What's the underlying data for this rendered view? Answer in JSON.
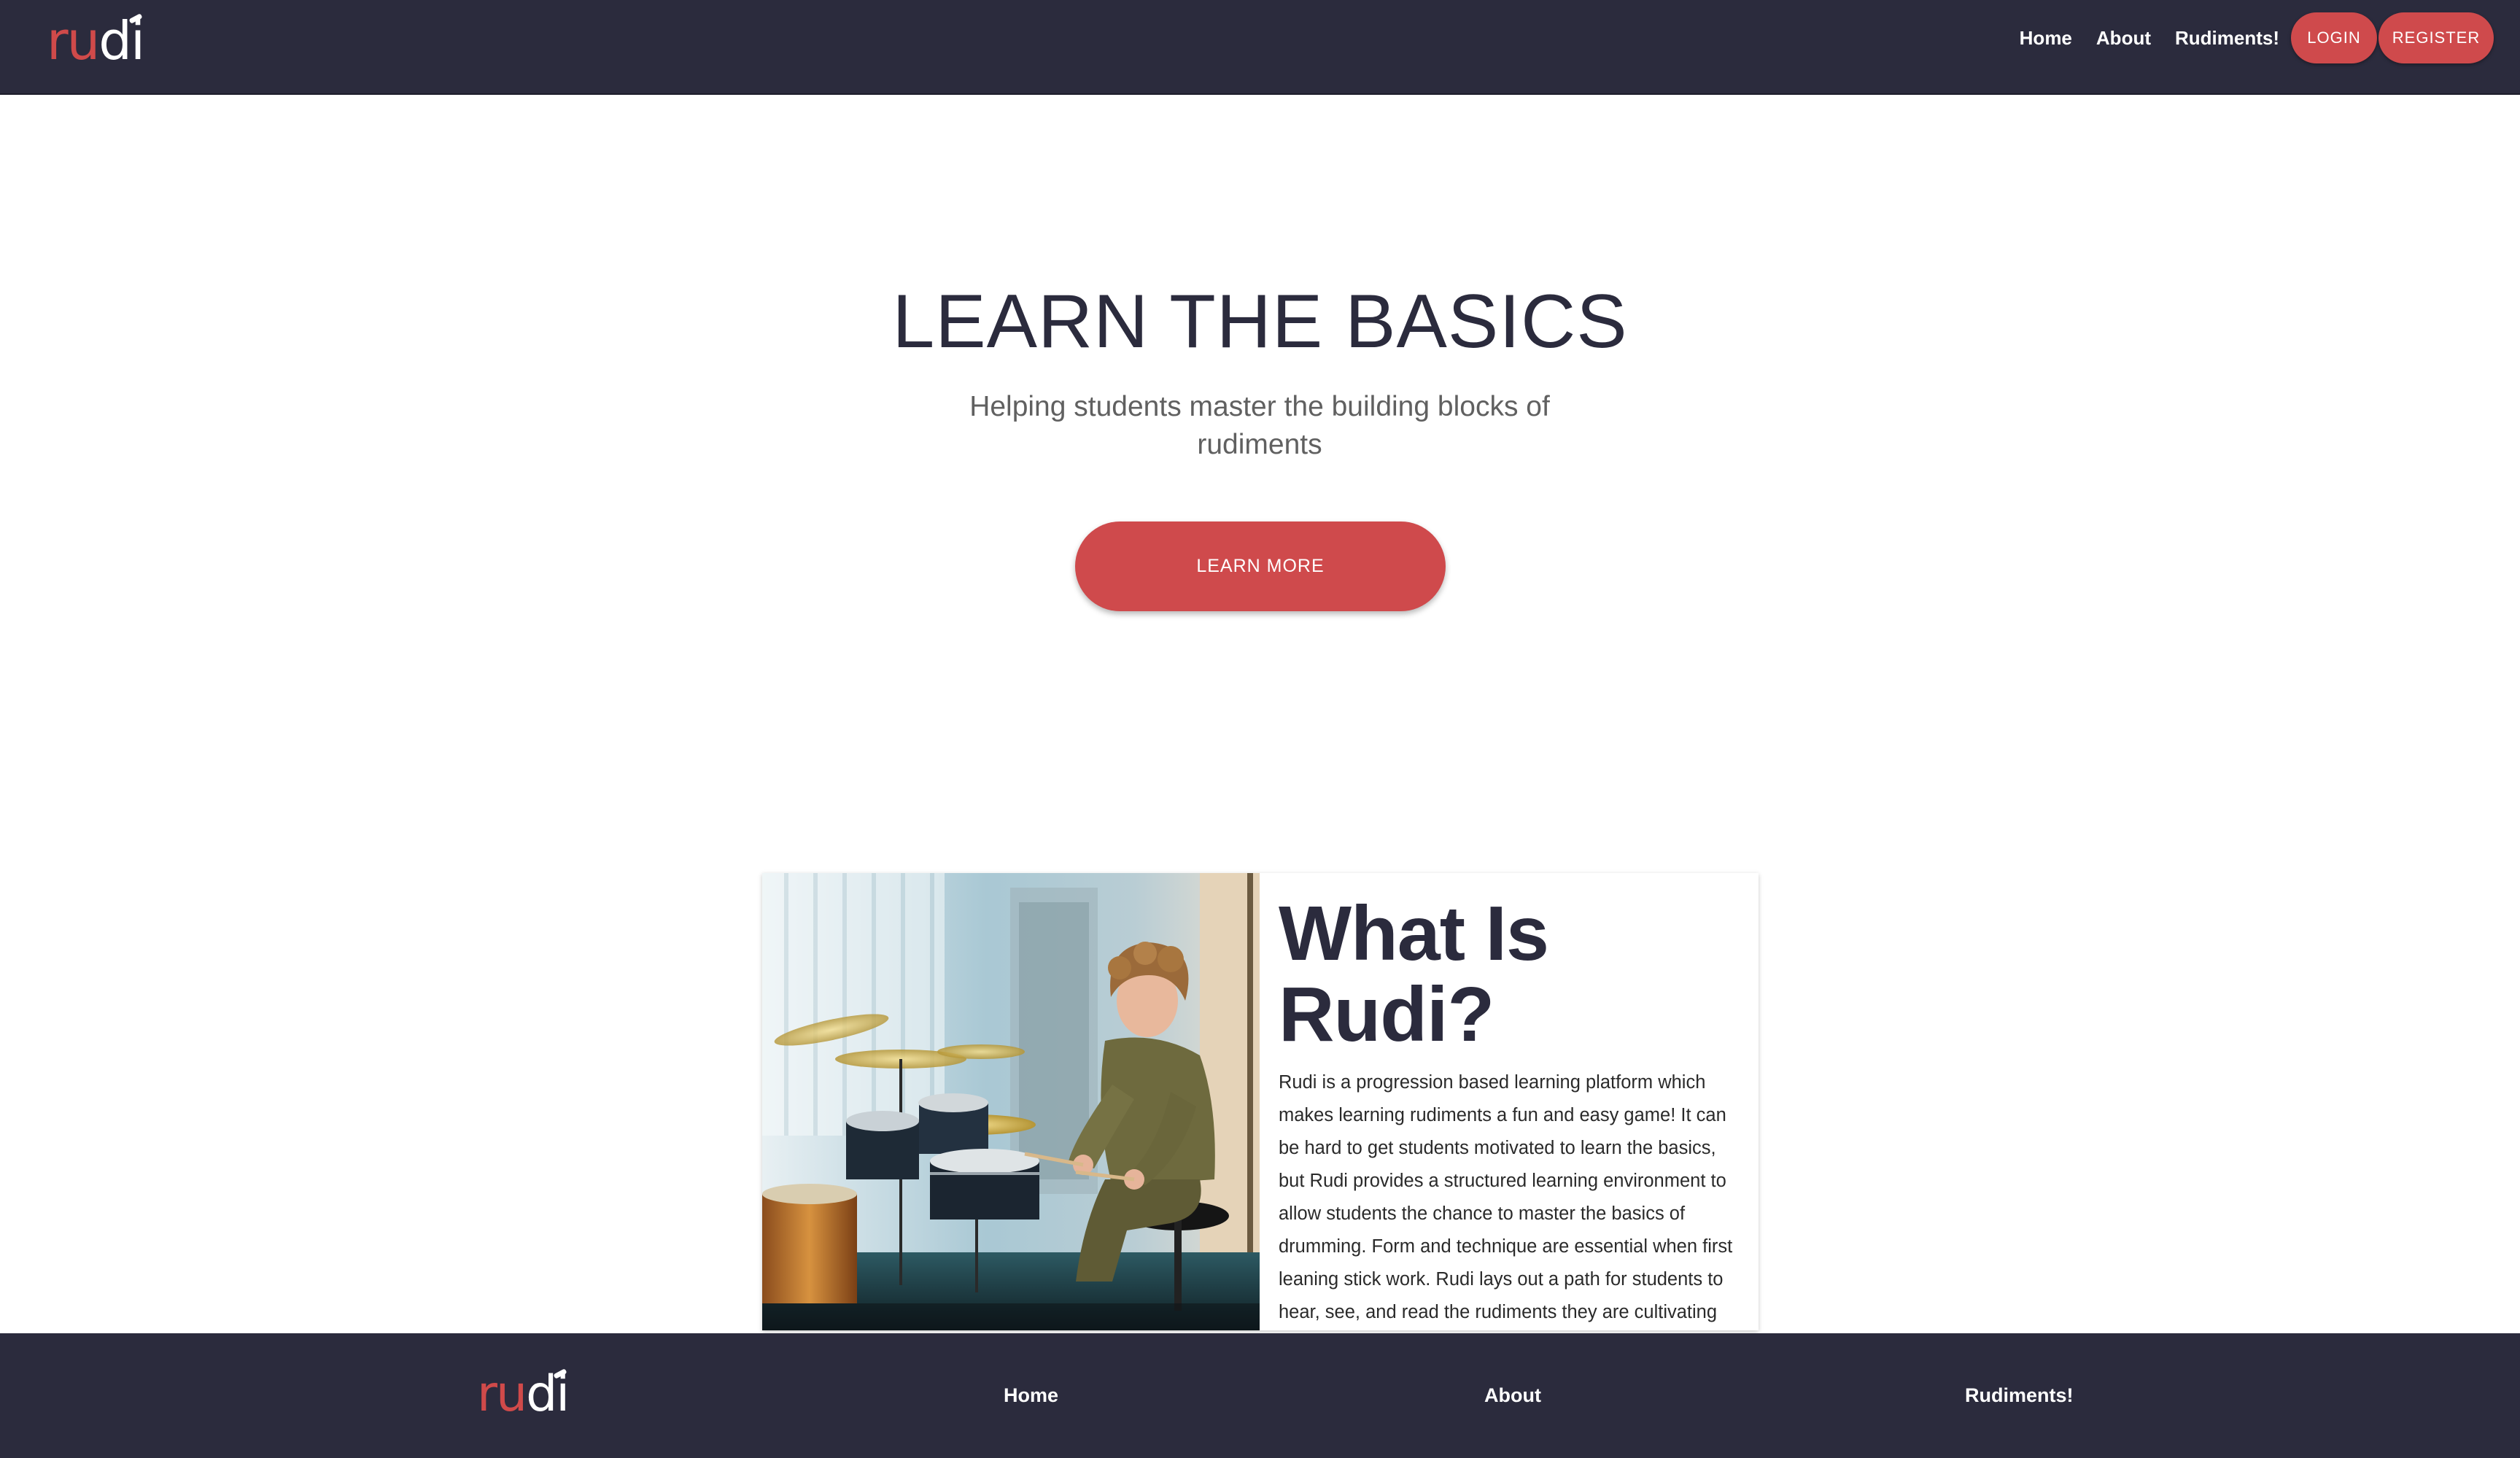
{
  "brand": {
    "logo_part1": "ru",
    "logo_part2": "di",
    "accent_color": "#cf4a4c",
    "dark_color": "#2b2b3d"
  },
  "nav": {
    "links": [
      "Home",
      "About",
      "Rudiments!"
    ],
    "login_label": "LOGIN",
    "register_label": "REGISTER"
  },
  "hero": {
    "title": "LEARN THE BASICS",
    "subtitle": "Helping students master the building blocks of rudiments",
    "cta_label": "LEARN MORE"
  },
  "about_card": {
    "image_subject": "drummer-photo",
    "title": "What Is Rudi?",
    "body": "Rudi is a progression based learning platform which makes learning rudiments a fun and easy game! It can be hard to get students motivated to learn the basics, but Rudi provides a structured learning environment to allow students the chance to master the basics of drumming. Form and technique are essential when first leaning stick work. Rudi lays out a path for students to hear, see, and read the rudiments they are cultivating their rudiment skills."
  },
  "footer": {
    "links": [
      "Home",
      "About",
      "Rudiments!"
    ]
  }
}
